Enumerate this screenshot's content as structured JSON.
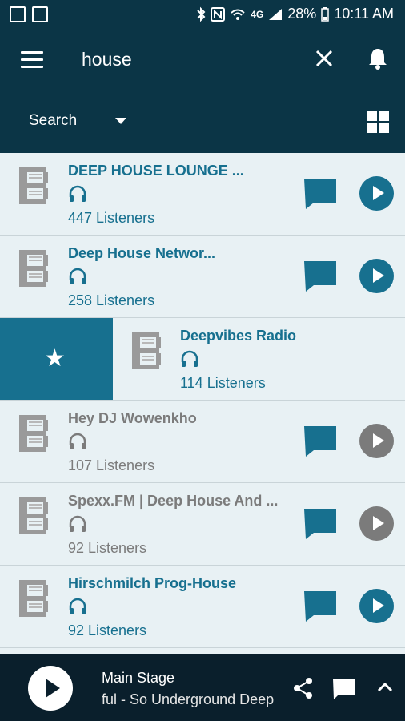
{
  "status_bar": {
    "battery": "28%",
    "time": "10:11 AM",
    "network": "4G"
  },
  "header": {
    "search_query": "house",
    "search_dropdown_label": "Search"
  },
  "stations": [
    {
      "title": "DEEP HOUSE LOUNGE ...",
      "listeners": "447 Listeners",
      "active": true
    },
    {
      "title": "Deep House Networ...",
      "listeners": "258 Listeners",
      "active": true
    },
    {
      "title": "Deepvibes Radio",
      "listeners": "114 Listeners",
      "active": true,
      "swiped": true
    },
    {
      "title": "Hey DJ Wowenkho",
      "listeners": "107 Listeners",
      "active": false
    },
    {
      "title": "Spexx.FM | Deep House And ...",
      "listeners": "92 Listeners",
      "active": false
    },
    {
      "title": "Hirschmilch Prog-House",
      "listeners": "92 Listeners",
      "active": true
    }
  ],
  "player": {
    "station": "Main Stage",
    "track": "ful - So Underground Deep"
  },
  "colors": {
    "header_bg": "#0b3546",
    "accent": "#17708f",
    "inactive": "#7b7b7b",
    "player_bg": "#0a1f2c",
    "list_bg": "#e8f1f4"
  },
  "icons": {
    "favorite": "★"
  }
}
